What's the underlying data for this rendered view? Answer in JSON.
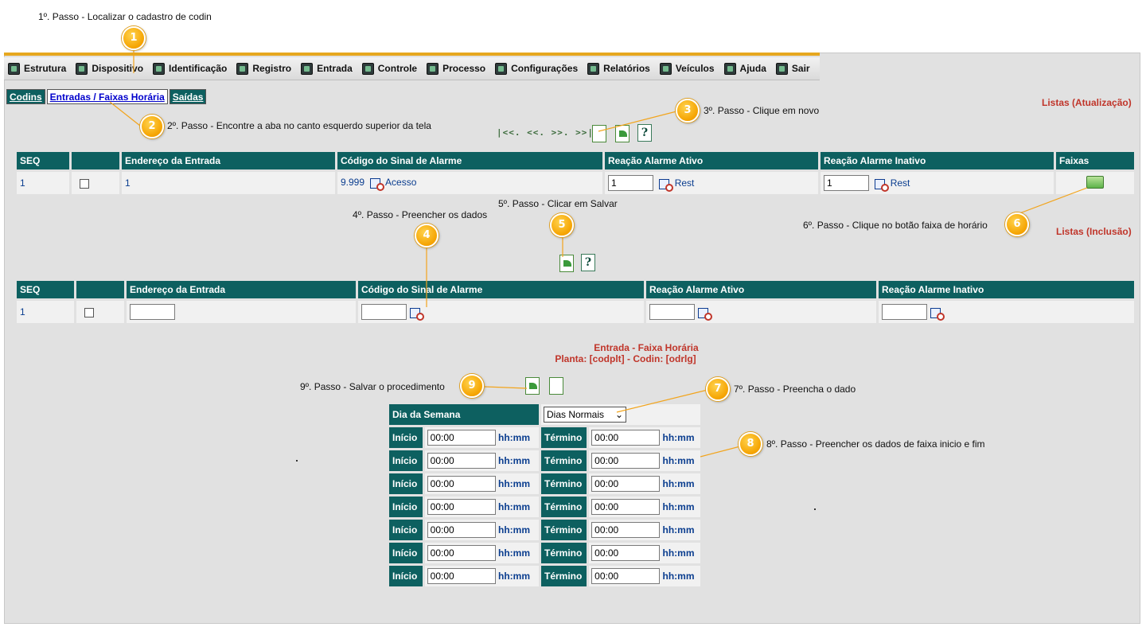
{
  "steps": {
    "s1": {
      "num": "1",
      "text": "1º. Passo - Localizar o cadastro de codin"
    },
    "s2": {
      "num": "2",
      "text": "2º. Passo - Encontre a aba no canto esquerdo superior da tela"
    },
    "s3": {
      "num": "3",
      "text": "3º. Passo - Clique em novo"
    },
    "s4": {
      "num": "4",
      "text": "4º. Passo - Preencher os dados"
    },
    "s5": {
      "num": "5",
      "text": "5º. Passo - Clicar em Salvar"
    },
    "s6": {
      "num": "6",
      "text": "6º. Passo - Clique no botão faixa de horário"
    },
    "s7": {
      "num": "7",
      "text": "7º. Passo - Preencha o dado"
    },
    "s8": {
      "num": "8",
      "text": "8º. Passo - Preencher os dados de faixa inicio e fim"
    },
    "s9": {
      "num": "9",
      "text": "9º. Passo - Salvar o procedimento"
    }
  },
  "menu": {
    "items": [
      {
        "label": "Estrutura"
      },
      {
        "label": "Dispositivo"
      },
      {
        "label": "Identificação"
      },
      {
        "label": "Registro"
      },
      {
        "label": "Entrada"
      },
      {
        "label": "Controle"
      },
      {
        "label": "Processo"
      },
      {
        "label": "Configurações"
      },
      {
        "label": "Relatórios"
      },
      {
        "label": "Veículos"
      },
      {
        "label": "Ajuda"
      },
      {
        "label": "Sair"
      }
    ]
  },
  "tabs": [
    {
      "label": "Codins",
      "active": false
    },
    {
      "label": "Entradas / Faixas Horária",
      "active": true
    },
    {
      "label": "Saídas",
      "active": false
    }
  ],
  "update_list": {
    "title": "Listas (Atualização)",
    "nav": "|<<. <<. >>. >>|",
    "columns": [
      "SEQ",
      "",
      "Endereço da Entrada",
      "Código do Sinal de Alarme",
      "Reação Alarme Ativo",
      "Reação Alarme Inativo",
      "Faixas"
    ],
    "row": {
      "seq": "1",
      "endereco": "1",
      "codigo": "9.999",
      "codigo_desc": "Acesso",
      "ativo": "1",
      "ativo_desc": "Rest",
      "inativo": "1",
      "inativo_desc": "Rest"
    }
  },
  "insert_list": {
    "title": "Listas (Inclusão)",
    "columns": [
      "SEQ",
      "",
      "Endereço da Entrada",
      "Código do Sinal de Alarme",
      "Reação Alarme Ativo",
      "Reação Alarme Inativo"
    ],
    "row": {
      "seq": "1"
    }
  },
  "faixa": {
    "title": "Entrada - Faixa Horária",
    "subtitle": "Planta: [codplt] - Codin: [odrlg]",
    "dia_label": "Dia da Semana",
    "dia_value": "Dias Normais",
    "inicio_label": "Início",
    "termino_label": "Término",
    "unit": "hh:mm",
    "rows": [
      {
        "inicio": "00:00",
        "termino": "00:00"
      },
      {
        "inicio": "00:00",
        "termino": "00:00"
      },
      {
        "inicio": "00:00",
        "termino": "00:00"
      },
      {
        "inicio": "00:00",
        "termino": "00:00"
      },
      {
        "inicio": "00:00",
        "termino": "00:00"
      },
      {
        "inicio": "00:00",
        "termino": "00:00"
      },
      {
        "inicio": "00:00",
        "termino": "00:00"
      }
    ]
  }
}
